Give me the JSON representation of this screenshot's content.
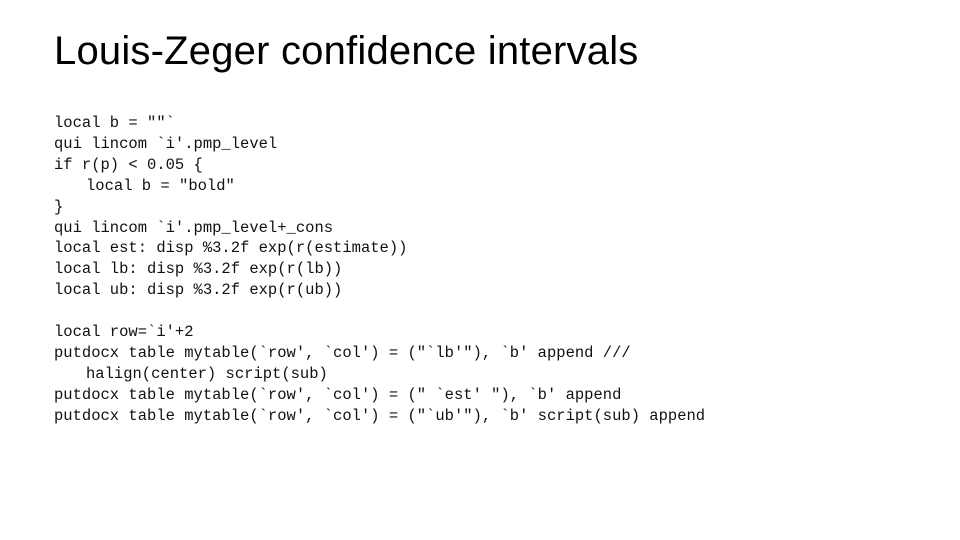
{
  "title": "Louis-Zeger confidence intervals",
  "code": {
    "l0": "local b = \"\"`",
    "l1": "qui lincom `i'.pmp_level",
    "l2": "if r(p) < 0.05 {",
    "l3": "local b = \"bold\"",
    "l4": "}",
    "l5": "qui lincom `i'.pmp_level+_cons",
    "l6": "local est: disp %3.2f exp(r(estimate))",
    "l7": "local lb: disp %3.2f exp(r(lb))",
    "l8": "local ub: disp %3.2f exp(r(ub))",
    "l9": "",
    "l10": "local row=`i'+2",
    "l11": "putdocx table mytable(`row', `col') = (\"`lb'\"), `b' append ///",
    "l12": "halign(center) script(sub)",
    "l13": "putdocx table mytable(`row', `col') = (\" `est' \"), `b' append",
    "l14": "putdocx table mytable(`row', `col') = (\"`ub'\"), `b' script(sub) append"
  }
}
